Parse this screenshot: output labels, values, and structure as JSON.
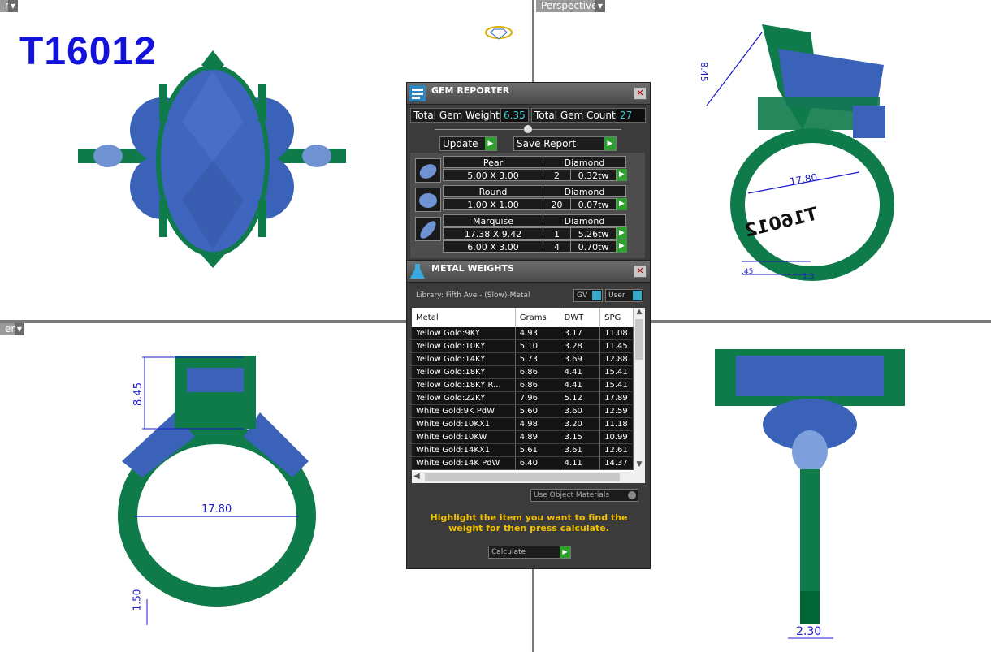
{
  "model_id": "T16012",
  "viewports": {
    "top_left": {
      "label": "n"
    },
    "top_right": {
      "label": "Perspective"
    },
    "bottom_left": {
      "label": "er"
    }
  },
  "dimensions": {
    "height_tr": "8.45",
    "width_tr": "17.80",
    "engraving": "T16012",
    "small_tr_1": ".45",
    "small_tr_2": "1.3",
    "height_bl": "8.45",
    "width_bl": "17.80",
    "thickness_bl": "1.50",
    "shank_br": "2.30"
  },
  "gem_reporter": {
    "title": "GEM REPORTER",
    "total_weight_label": "Total Gem Weight",
    "total_weight_value": "6.35",
    "total_count_label": "Total Gem Count",
    "total_count_value": "27",
    "update_label": "Update",
    "save_label": "Save Report",
    "gems": [
      {
        "shape": "Pear",
        "type": "Diamond",
        "rows": [
          {
            "size": "5.00 X 3.00",
            "qty": "2",
            "tw": "0.32tw"
          }
        ]
      },
      {
        "shape": "Round",
        "type": "Diamond",
        "rows": [
          {
            "size": "1.00 X 1.00",
            "qty": "20",
            "tw": "0.07tw"
          }
        ]
      },
      {
        "shape": "Marquise",
        "type": "Diamond",
        "rows": [
          {
            "size": "17.38 X 9.42",
            "qty": "1",
            "tw": "5.26tw"
          },
          {
            "size": "6.00 X 3.00",
            "qty": "4",
            "tw": "0.70tw"
          }
        ]
      }
    ]
  },
  "metal_weights": {
    "title": "METAL WEIGHTS",
    "library": "Library: Fifth Ave - (Slow)-Metal",
    "gv_label": "GV",
    "user_label": "User",
    "headers": [
      "Metal",
      "Grams",
      "DWT",
      "SPG"
    ],
    "rows": [
      [
        "Yellow Gold:9KY",
        "4.93",
        "3.17",
        "11.08"
      ],
      [
        "Yellow Gold:10KY",
        "5.10",
        "3.28",
        "11.45"
      ],
      [
        "Yellow Gold:14KY",
        "5.73",
        "3.69",
        "12.88"
      ],
      [
        "Yellow Gold:18KY",
        "6.86",
        "4.41",
        "15.41"
      ],
      [
        "Yellow Gold:18KY R...",
        "6.86",
        "4.41",
        "15.41"
      ],
      [
        "Yellow Gold:22KY",
        "7.96",
        "5.12",
        "17.89"
      ],
      [
        "White Gold:9K PdW",
        "5.60",
        "3.60",
        "12.59"
      ],
      [
        "White Gold:10KX1",
        "4.98",
        "3.20",
        "11.18"
      ],
      [
        "White Gold:10KW",
        "4.89",
        "3.15",
        "10.99"
      ],
      [
        "White Gold:14KX1",
        "5.61",
        "3.61",
        "12.61"
      ],
      [
        "White Gold:14K PdW",
        "6.40",
        "4.11",
        "14.37"
      ]
    ],
    "use_object_label": "Use Object Materials",
    "hint": "Highlight the item you want to find the weight for then press calculate.",
    "calculate_label": "Calculate"
  },
  "colors": {
    "metal": "#0f7a4a",
    "gem": "#3a62b8",
    "dimension": "#1a1acc",
    "hint": "#f0c000"
  }
}
